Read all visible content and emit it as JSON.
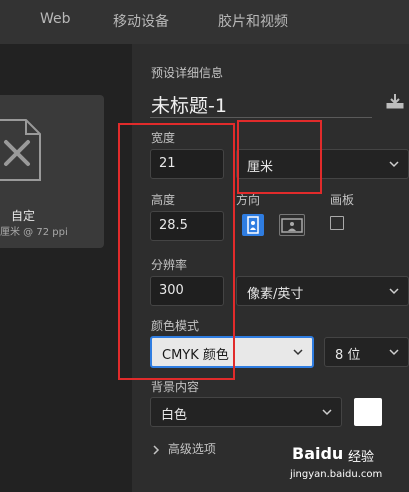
{
  "top_tabs": [
    "Web",
    "移动设备",
    "胶片和视频"
  ],
  "preset": {
    "name": "自定",
    "subtitle": "厘米 @ 72 ppi",
    "icon": "document-ruler-pencil-icon"
  },
  "details": {
    "section_label": "预设详细信息",
    "title": "未标题-1",
    "save_icon": "save-preset-download-icon",
    "width_label": "宽度",
    "width_value": "21",
    "unit_value": "厘米",
    "height_label": "高度",
    "height_value": "28.5",
    "orientation_label": "方向",
    "artboard_label": "画板",
    "resolution_label": "分辨率",
    "resolution_value": "300",
    "resolution_unit": "像素/英寸",
    "color_mode_label": "颜色模式",
    "color_mode_value": "CMYK 颜色",
    "bit_depth_value": "8 位",
    "background_label": "背景内容",
    "background_value": "白色",
    "background_color": "#ffffff",
    "advanced_label": "高级选项"
  },
  "accent_color": "#2f7de1",
  "annotation_color": "#e12b2b",
  "watermark": {
    "logo": "Baidu",
    "suffix": "经验",
    "url": "jingyan.baidu.com"
  }
}
